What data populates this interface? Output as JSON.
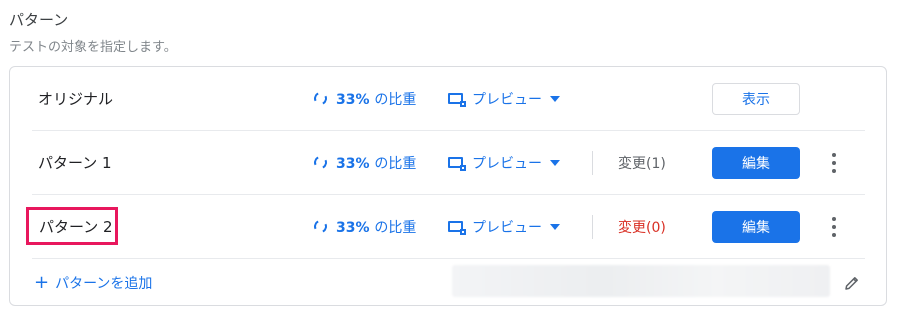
{
  "header": {
    "title": "パターン",
    "subtitle": "テストの対象を指定します。"
  },
  "patterns": [
    {
      "name": "オリジナル",
      "weight": "33%",
      "weight_suffix": "の比重",
      "preview": "プレビュー",
      "action": "表示"
    },
    {
      "name": "パターン 1",
      "weight": "33%",
      "weight_suffix": "の比重",
      "preview": "プレビュー",
      "changes": "変更(1)",
      "action": "編集"
    },
    {
      "name": "パターン 2",
      "weight": "33%",
      "weight_suffix": "の比重",
      "preview": "プレビュー",
      "changes": "変更(0)",
      "action": "編集"
    }
  ],
  "add_pattern": {
    "label": "パターンを追加"
  },
  "colors": {
    "accent": "#1a73e8",
    "highlight": "#e8175d",
    "changes_zero": "#d93025"
  }
}
